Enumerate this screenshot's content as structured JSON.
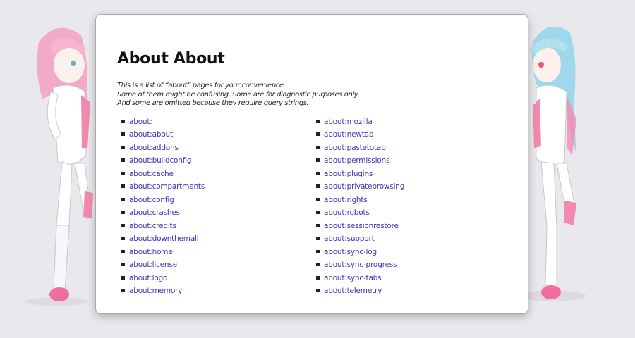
{
  "page": {
    "title": "About About",
    "intro": [
      "This is a list of “about” pages for your convenience.",
      "Some of them might be confusing. Some are for diagnostic purposes only.",
      "And some are omitted because they require query strings."
    ]
  },
  "links_left": [
    "about:",
    "about:about",
    "about:addons",
    "about:buildconfig",
    "about:cache",
    "about:compartments",
    "about:config",
    "about:crashes",
    "about:credits",
    "about:downthemall",
    "about:home",
    "about:license",
    "about:logo",
    "about:memory"
  ],
  "links_right": [
    "about:mozilla",
    "about:newtab",
    "about:pastetotab",
    "about:permissions",
    "about:plugins",
    "about:privatebrowsing",
    "about:rights",
    "about:robots",
    "about:sessionrestore",
    "about:support",
    "about:sync-log",
    "about:sync-progress",
    "about:sync-tabs",
    "about:telemetry"
  ],
  "colors": {
    "background": "#e9e8ec",
    "link": "#3b35b9",
    "left_character_hair": "#f3a9c8",
    "right_character_hair": "#9fd8ea"
  },
  "decorations": {
    "left": "anime-girl-pink-hair",
    "right": "anime-girl-blue-hair"
  }
}
